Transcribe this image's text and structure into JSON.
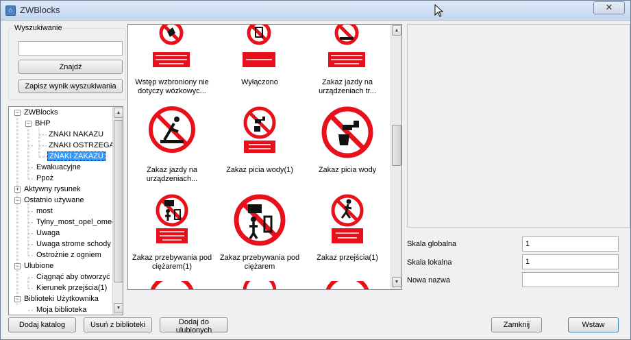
{
  "window": {
    "title": "ZWBlocks",
    "close_symbol": "✕"
  },
  "search": {
    "group_label": "Wyszukiwanie",
    "input_value": "",
    "find_button": "Znajdź",
    "save_button": "Zapisz wynik wyszukiwania"
  },
  "tree": {
    "nodes": [
      "ZWBlocks",
      "BHP",
      "ZNAKI NAKAZU",
      "ZNAKI OSTRZEGAW",
      "ZNAKI ZAKAZU",
      "Ewakuacyjne",
      "Ppoż",
      "Aktywny rysunek",
      "Ostatnio używane",
      "most",
      "Tylny_most_opel_omeg",
      "Uwaga",
      "Uwaga strome schody",
      "Ostrożnie z ogniem",
      "Ulubione",
      "Ciągnąć aby otworzyć",
      "Kierunek przejścia(1)",
      "Biblioteki Użytkownika",
      "Moja biblioteka"
    ],
    "expand_minus": "−",
    "expand_plus": "+"
  },
  "grid": {
    "items": [
      {
        "caption_1": "Wstęp wzbroniony nie",
        "caption_2": "dotyczy wózkowyc...",
        "label": "WSTĘP WZBRONIONY NIE DOTYCZY WÓZKOWYCH"
      },
      {
        "caption_1": "Wyłączono",
        "caption_2": "",
        "label": "WYŁĄCZONO"
      },
      {
        "caption_1": "Zakaz jazdy na",
        "caption_2": "urządzeniach tr...",
        "label": "ZAKAZ JAZDY NA URZĄDZENIACH"
      },
      {
        "caption_1": "Zakaz jazdy na",
        "caption_2": "urządzeniach...",
        "label": ""
      },
      {
        "caption_1": "Zakaz picia wody(1)",
        "caption_2": "",
        "label": "ZAKAZ PICIA WODY"
      },
      {
        "caption_1": "Zakaz picia wody",
        "caption_2": "",
        "label": ""
      },
      {
        "caption_1": "Zakaz przebywania pod",
        "caption_2": "ciężarem(1)",
        "label": "ZAKAZ PRZEBYWANIA POD CIĘŻAREM"
      },
      {
        "caption_1": "Zakaz przebywania pod",
        "caption_2": "ciężarem",
        "label": ""
      },
      {
        "caption_1": "Zakaz przejścia(1)",
        "caption_2": "",
        "label": "ZAKAZ PRZEJŚCIA"
      }
    ]
  },
  "props": {
    "global_scale_label": "Skala globalna",
    "global_scale_value": "1",
    "local_scale_label": "Skala lokalna",
    "local_scale_value": "1",
    "new_name_label": "Nowa nazwa",
    "new_name_value": ""
  },
  "footer": {
    "add_catalog": "Dodaj katalog",
    "remove_from_library": "Usuń z biblioteki",
    "add_to_favorites": "Dodaj do ulubionych",
    "close": "Zamknij",
    "insert": "Wstaw"
  },
  "colors": {
    "sign_red": "#e8101a",
    "selection": "#3399ff"
  }
}
